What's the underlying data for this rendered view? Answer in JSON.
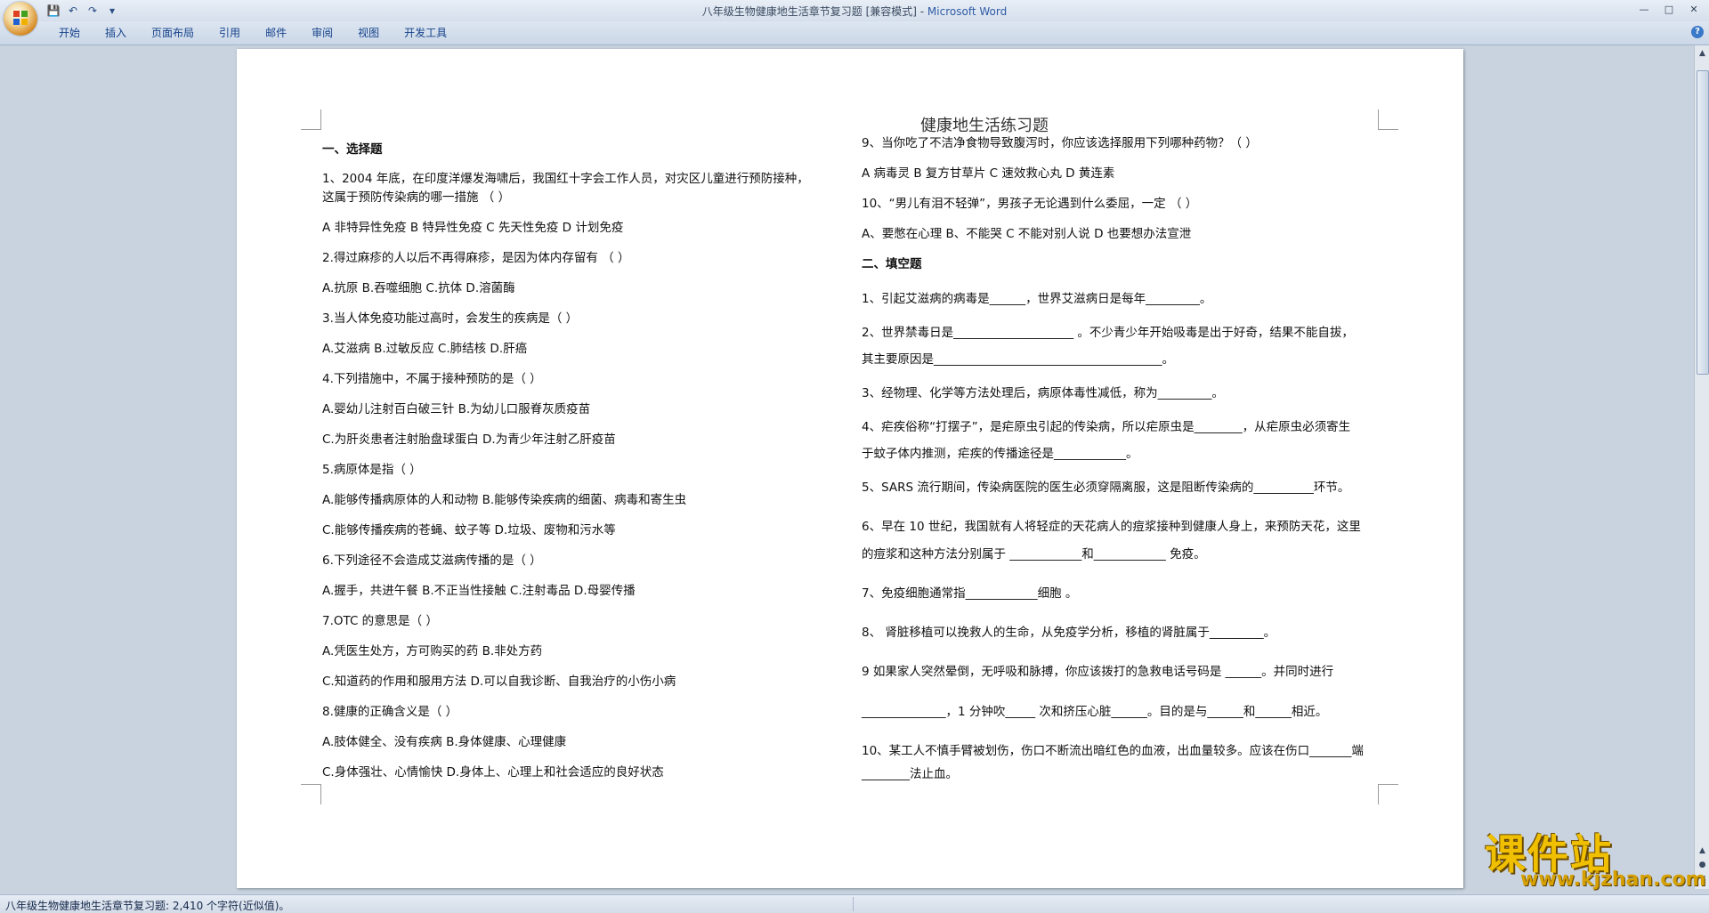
{
  "window": {
    "title": "八年级生物健康地生活章节复习题 [兼容模式] - ",
    "app_name": "Microsoft Word"
  },
  "qat": {
    "save": "💾",
    "undo": "↶",
    "redo": "↷",
    "more": "▾"
  },
  "ribbon": {
    "tabs": [
      "开始",
      "插入",
      "页面布局",
      "引用",
      "邮件",
      "审阅",
      "视图",
      "开发工具"
    ]
  },
  "document": {
    "title": "健康地生活练习题",
    "left_lines": [
      "一、选择题",
      "    1、2004 年底，在印度洋爆发海啸后，我国红十字会工作人员，对灾区儿童进行预防接种，",
      "这属于预防传染病的哪一措施      （      ）",
      "    A 非特异性免疫    B 特异性免疫    C 先天性免疫    D 计划免疫",
      "2.得过麻疹的人以后不再得麻疹，是因为体内存留有                 （      ）",
      "    A.抗原        B.吞噬细胞        C.抗体        D.溶菌酶",
      "3.当人体免疫功能过高时，会发生的疾病是（      ）",
      "    A.艾滋病    B.过敏反应    C.肺结核    D.肝癌",
      "4.下列措施中，不属于接种预防的是（      ）",
      "    A.婴幼儿注射百白破三针                                     B.为幼儿口服脊灰质疫苗",
      "    C.为肝炎患者注射胎盘球蛋白                              D.为青少年注射乙肝疫苗",
      "5.病原体是指（      ）",
      "    A.能够传播病原体的人和动物                     B.能够传染疾病的细菌、病毒和寄生虫",
      "    C.能够传播疾病的苍蝇、蚊子等                  D.垃圾、废物和污水等",
      "6.下列途径不会造成艾滋病传播的是（      ）",
      "    A.握手，共进午餐      B.不正当性接触      C.注射毒品      D.母婴传播",
      "7.OTC 的意思是（      ）",
      "    A.凭医生处方，方可购买的药             B.非处方药",
      "    C.知道药的作用和服用方法                          D.可以自我诊断、自我治疗的小伤小病",
      "8.健康的正确含义是（      ）",
      "A.肢体健全、没有疾病                       B.身体健康、心理健康",
      "C.身体强壮、心情愉快                       D.身体上、心理上和社会适应的良好状态"
    ],
    "right_lines": [
      "9、当你吃了不洁净食物导致腹泻时，你应该选择服用下列哪种药物？（          ）",
      "    A 病毒灵      B 复方甘草片      C 速效救心丸      D 黄连素",
      "10、“男儿有泪不轻弹”，男孩子无论遇到什么委屈，一定            （            ）",
      "    A、要憋在心理      B、不能哭      C 不能对别人说      D 也要想办法宣泄",
      "二、填空题",
      "1、引起艾滋病的病毒是______，世界艾滋病日是每年_________。",
      "2、世界禁毒日是____________________ 。不少青少年开始吸毒是出于好奇，结果不能自拔，",
      "其主要原因是______________________________________。",
      "3、经物理、化学等方法处理后，病原体毒性减低，称为_________。",
      "4、疟疾俗称“打摆子”，是疟原虫引起的传染病，所以疟原虫是________，从疟原虫必须寄生",
      "于蚊子体内推测，疟疾的传播途径是____________。",
      "5、SARS 流行期间，传染病医院的医生必须穿隔离服，这是阻断传染病的__________环节。",
      "6、早在 10 世纪，我国就有人将轻症的天花病人的痘浆接种到健康人身上，来预防天花，这里",
      "的痘浆和这种方法分别属于 ____________和____________ 免疫。",
      "7、免疫细胞通常指____________细胞 。",
      "8、  肾脏移植可以挽救人的生命，从免疫学分析，移植的肾脏属于_________。",
      "9 如果家人突然晕倒，无呼吸和脉搏，你应该拨打的急救电话号码是 ______。并同时进行",
      "______________，1 分钟吹_____ 次和挤压心脏______。目的是与______和______相近。",
      "10、某工人不慎手臂被划伤，伤口不断流出暗红色的血液，出血量较多。应该在伤口_______端",
      "                  ________法止血。"
    ]
  },
  "statusbar": {
    "text": "八年级生物健康地生活章节复习题: 2,410 个字符(近似值)。"
  },
  "watermark": {
    "text": "课件站",
    "url": "www.kjzhan.com"
  }
}
